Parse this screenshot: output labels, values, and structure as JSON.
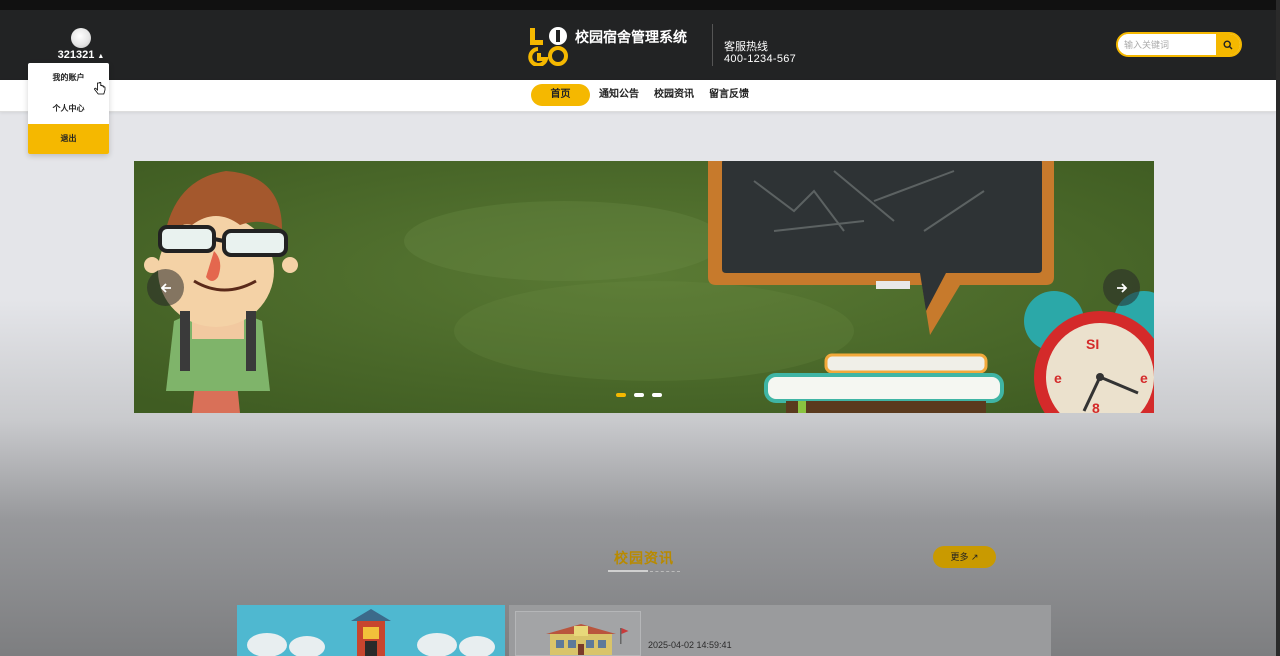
{
  "header": {
    "username": "321321",
    "site_title": "校园宿舍管理系统",
    "hotline_label": "客服热线",
    "hotline_number": "400-1234-567",
    "search_placeholder": "输入关键词",
    "logo_icon": "logo-letters-icon"
  },
  "user_menu": {
    "items": [
      {
        "label": "我的账户"
      },
      {
        "label": "个人中心"
      },
      {
        "label": "退出"
      }
    ]
  },
  "nav": {
    "items": [
      {
        "label": "首页",
        "active": true
      },
      {
        "label": "通知公告"
      },
      {
        "label": "校园资讯"
      },
      {
        "label": "留言反馈"
      }
    ]
  },
  "carousel": {
    "slide_count": 3,
    "active_index": 0
  },
  "news_section": {
    "title": "校园资讯",
    "more_label": "更多",
    "items": [
      {
        "date": "2025-04-02 14:59:41"
      }
    ]
  },
  "colors": {
    "accent": "#f5b800",
    "header_bg": "#222324",
    "chalkboard": "#4f6f2c"
  }
}
